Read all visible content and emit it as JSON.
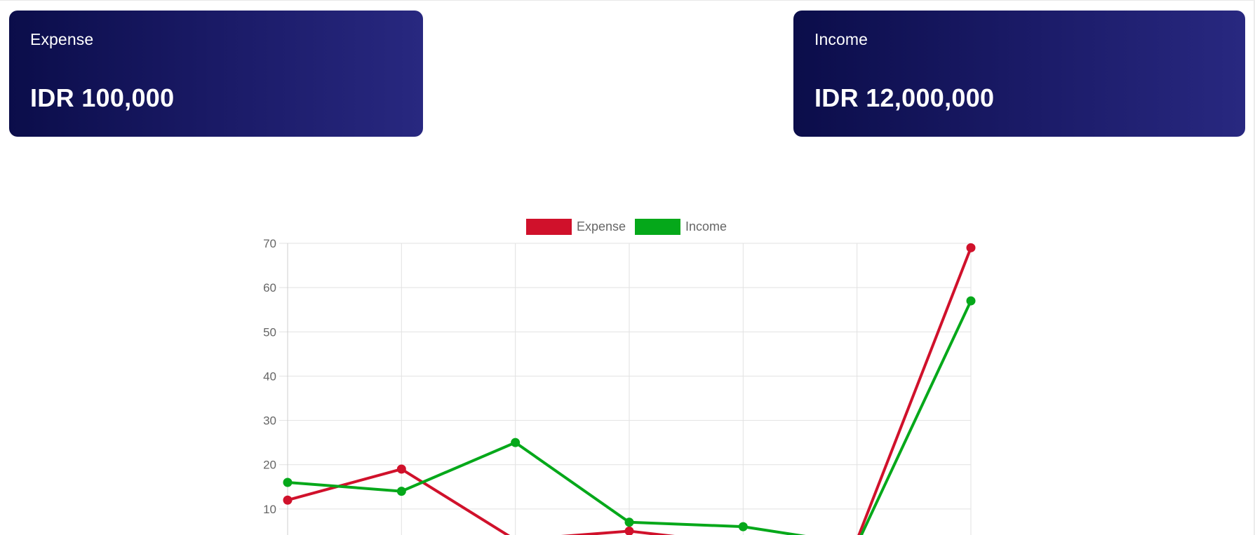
{
  "cards": {
    "expense": {
      "label": "Expense",
      "value": "IDR 100,000"
    },
    "income": {
      "label": "Income",
      "value": "IDR 12,000,000"
    }
  },
  "colors": {
    "card_gradient_start": "#0b0d4a",
    "card_gradient_end": "#282880",
    "expense": "#d0112b",
    "income": "#05a81a",
    "grid": "#e2e2e2",
    "tick_text": "#666666"
  },
  "chart_data": {
    "type": "line",
    "legend": {
      "position": "top",
      "items": [
        "Expense",
        "Income"
      ]
    },
    "grid": true,
    "ylim": [
      0,
      70
    ],
    "y_ticks": [
      10,
      20,
      30,
      40,
      50,
      60,
      70
    ],
    "x_count": 7,
    "series": [
      {
        "name": "Expense",
        "color": "#d0112b",
        "values": [
          12,
          19,
          3,
          5,
          2,
          3,
          69
        ]
      },
      {
        "name": "Income",
        "color": "#05a81a",
        "values": [
          16,
          14,
          25,
          7,
          6,
          2,
          57
        ]
      }
    ]
  }
}
